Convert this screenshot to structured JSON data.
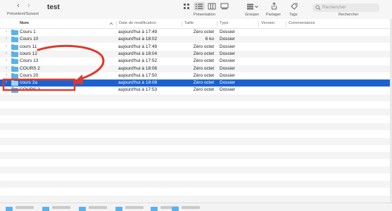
{
  "window": {
    "title": "test",
    "nav_label": "Précédent/Suivant",
    "back_glyph": "‹",
    "forward_glyph": "›"
  },
  "toolbar": {
    "view_label": "Présentation",
    "group_label": "Grouper",
    "share_label": "Partager",
    "tags_label": "Tags",
    "search_label": "Rechercher",
    "search_placeholder": "Rechercher"
  },
  "columns": {
    "name": "Nom",
    "date": "Date de modification",
    "size": "Taille",
    "kind": "Type",
    "version": "Version",
    "comments": "Commentaires"
  },
  "rows": [
    {
      "name": "Cours 1",
      "date": "aujourd'hui à 17:49",
      "size": "Zéro octet",
      "kind": "Dossier"
    },
    {
      "name": "Cours 10",
      "date": "aujourd'hui à 18:02",
      "size": "6 ko",
      "kind": "Dossier"
    },
    {
      "name": "cours 11",
      "date": "aujourd'hui à 17:49",
      "size": "Zéro octet",
      "kind": "Dossier"
    },
    {
      "name": "cours 12",
      "date": "aujourd'hui à 18:04",
      "size": "Zéro octet",
      "kind": "Dossier"
    },
    {
      "name": "Cours 13",
      "date": "aujourd'hui à 17:52",
      "size": "Zéro octet",
      "kind": "Dossier"
    },
    {
      "name": "COURS 2",
      "date": "aujourd'hui à 18:06",
      "size": "Zéro octet",
      "kind": "Dossier"
    },
    {
      "name": "Cours 20",
      "date": "aujourd'hui à 17:50",
      "size": "Zéro octet",
      "kind": "Dossier"
    },
    {
      "name": "cours 2a",
      "date": "aujourd'hui à 18:08",
      "size": "Zéro octet",
      "kind": "Dossier"
    },
    {
      "name": "COURS 3",
      "date": "aujourd'hui à 17:53",
      "size": "Zéro octet",
      "kind": "Dossier"
    }
  ],
  "selected_row": 7,
  "colors": {
    "selection": "#1b62d0",
    "annotation": "#e0392b",
    "folder": "#5ab2ec"
  },
  "icons": {
    "toolbar": [
      "grid-view-icon",
      "list-view-icon",
      "column-view-icon",
      "gallery-view-icon",
      "group-icon",
      "share-icon",
      "tag-icon",
      "search-icon"
    ],
    "row": [
      "disclosure-triangle-icon",
      "folder-icon"
    ]
  }
}
